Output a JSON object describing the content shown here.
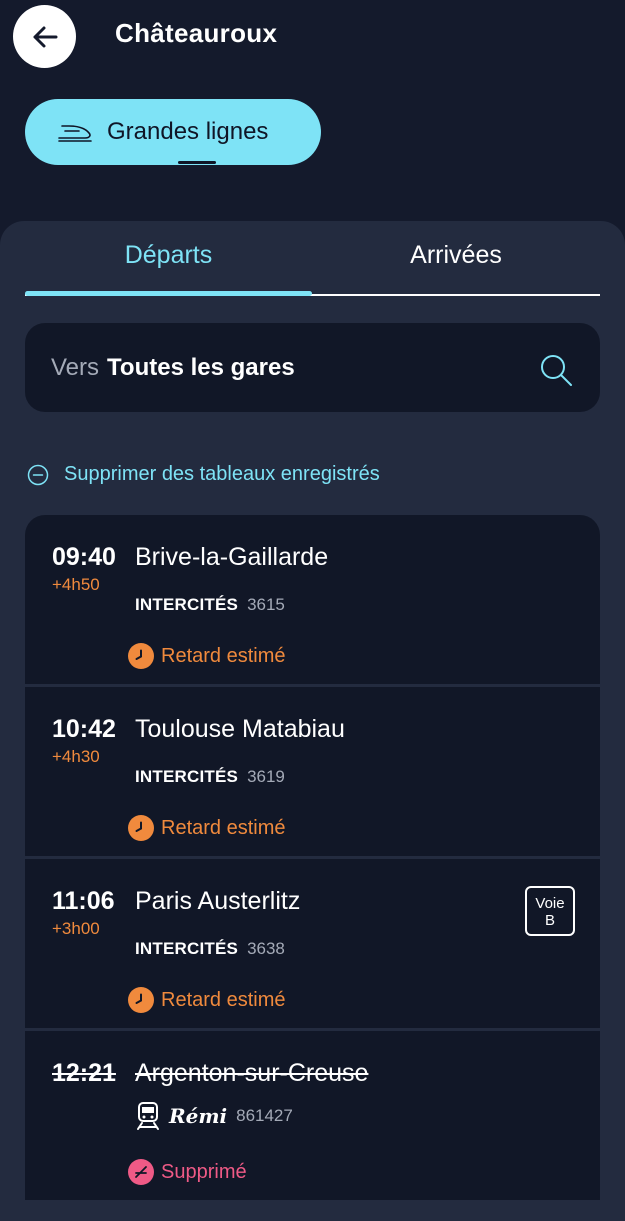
{
  "header": {
    "title": "Châteauroux",
    "back_icon": "arrow-left-icon"
  },
  "filter": {
    "label": "Grandes lignes",
    "icon": "train-icon",
    "accent": "#7ee3f6"
  },
  "tabs": [
    {
      "label": "Départs",
      "active": true
    },
    {
      "label": "Arrivées",
      "active": false
    }
  ],
  "search": {
    "prefix": "Vers",
    "value": "Toutes les gares",
    "icon": "search-icon"
  },
  "remove_saved": {
    "label": "Supprimer des tableaux enregistrés",
    "icon": "minus-circle-icon"
  },
  "departures": [
    {
      "time": "09:40",
      "delay": "+4h50",
      "destination": "Brive-la-Gaillarde",
      "brand": "INTERCITÉS",
      "number": "3615",
      "status": "Retard estimé",
      "status_type": "late"
    },
    {
      "time": "10:42",
      "delay": "+4h30",
      "destination": "Toulouse Matabiau",
      "brand": "INTERCITÉS",
      "number": "3619",
      "status": "Retard estimé",
      "status_type": "late"
    },
    {
      "time": "11:06",
      "delay": "+3h00",
      "destination": "Paris Austerlitz",
      "brand": "INTERCITÉS",
      "number": "3638",
      "status": "Retard estimé",
      "status_type": "late",
      "platform": {
        "label": "Voie",
        "value": "B"
      }
    },
    {
      "time": "12:21",
      "delay": "",
      "destination": "Argenton-sur-Creuse",
      "brand": "Rémi",
      "number": "861427",
      "status": "Supprimé",
      "status_type": "cancelled"
    }
  ],
  "colors": {
    "background": "#141a2c",
    "panel": "#232b3f",
    "card": "#111727",
    "late": "#f08a3d",
    "cancelled": "#ef5a86"
  }
}
